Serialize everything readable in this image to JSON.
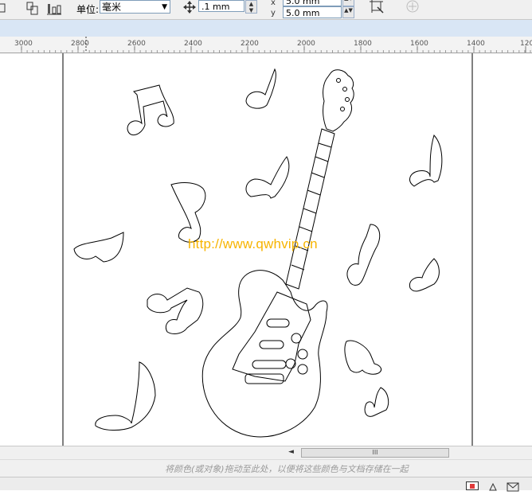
{
  "toolbar": {
    "unit_label": "单位:",
    "unit_value": "毫米",
    "nudge_value": ".1 mm",
    "dup_x_value": "5.0 mm",
    "dup_y_value": "5.0 mm"
  },
  "ruler": {
    "labels": [
      "3000",
      "2800",
      "2600",
      "2400",
      "2200",
      "2000",
      "1800",
      "1600",
      "1400",
      "120"
    ]
  },
  "canvas": {
    "watermark": "http://www.qwhvip.cn"
  },
  "scrollbar": {
    "thumb_grip": "III",
    "left_arrow": "◄"
  },
  "status": {
    "hint": "将颜色(或对象)拖动至此处，以便将这些颜色与文档存储在一起"
  },
  "colors": {
    "toolbar_bg": "#f0f0f0",
    "ruler_bg": "#f3f3f3",
    "watermark": "#f7b400",
    "drawing_stroke": "#000000"
  }
}
